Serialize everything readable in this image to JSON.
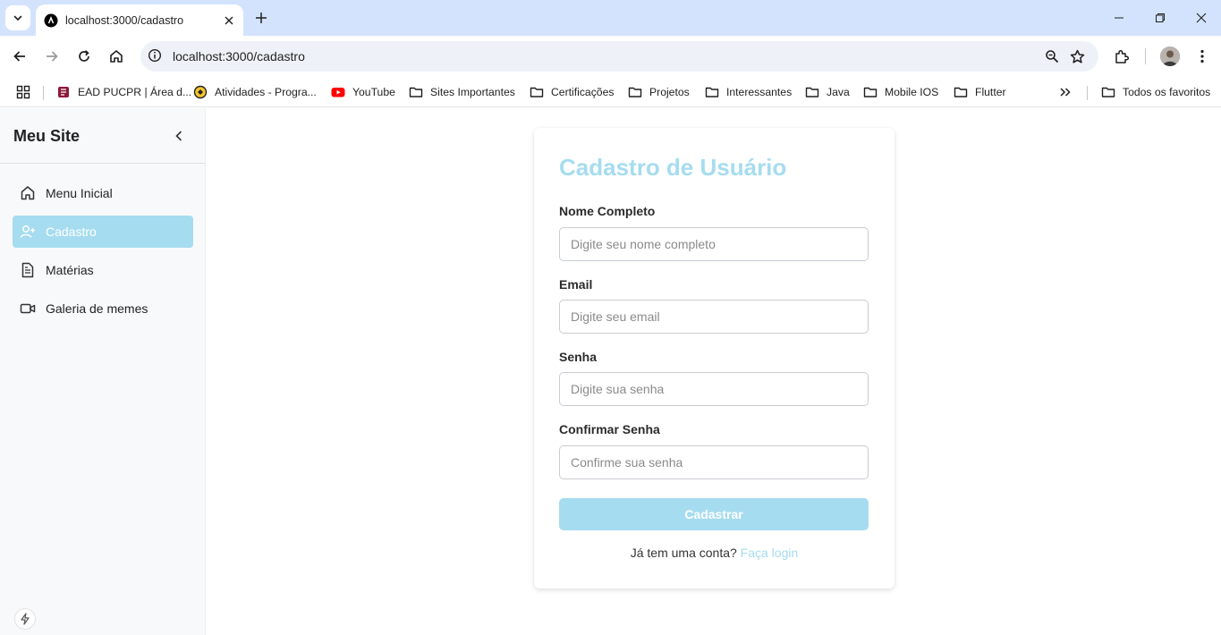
{
  "browser": {
    "tab_title": "localhost:3000/cadastro",
    "url": "localhost:3000/cadastro",
    "bookmarks": [
      {
        "label": "EAD PUCPR | Área d...",
        "icon": "pucpr-favicon"
      },
      {
        "label": "Atividades - Progra...",
        "icon": "atividades-favicon"
      },
      {
        "label": "YouTube",
        "icon": "youtube-icon"
      },
      {
        "label": "Sites Importantes",
        "icon": "folder-icon"
      },
      {
        "label": "Certificações",
        "icon": "folder-icon"
      },
      {
        "label": "Projetos",
        "icon": "folder-icon"
      },
      {
        "label": "Interessantes",
        "icon": "folder-icon"
      },
      {
        "label": "Java",
        "icon": "folder-icon"
      },
      {
        "label": "Mobile IOS",
        "icon": "folder-icon"
      },
      {
        "label": "Flutter",
        "icon": "folder-icon"
      }
    ],
    "all_bookmarks_label": "Todos os favoritos"
  },
  "sidebar": {
    "title": "Meu Site",
    "items": [
      {
        "label": "Menu Inicial",
        "icon": "home-icon",
        "active": false
      },
      {
        "label": "Cadastro",
        "icon": "user-plus-icon",
        "active": true
      },
      {
        "label": "Matérias",
        "icon": "document-icon",
        "active": false
      },
      {
        "label": "Galeria de memes",
        "icon": "video-icon",
        "active": false
      }
    ]
  },
  "form": {
    "title": "Cadastro de Usuário",
    "fields": [
      {
        "label": "Nome Completo",
        "placeholder": "Digite seu nome completo",
        "value": ""
      },
      {
        "label": "Email",
        "placeholder": "Digite seu email",
        "value": ""
      },
      {
        "label": "Senha",
        "placeholder": "Digite sua senha",
        "value": ""
      },
      {
        "label": "Confirmar Senha",
        "placeholder": "Confirme sua senha",
        "value": ""
      }
    ],
    "submit_label": "Cadastrar",
    "login_prompt": "Já tem uma conta?",
    "login_link": "Faça login"
  },
  "colors": {
    "accent": "#a6dcef",
    "tabstrip": "#d3e3fd",
    "sidebar_bg": "#f8f9fa"
  }
}
